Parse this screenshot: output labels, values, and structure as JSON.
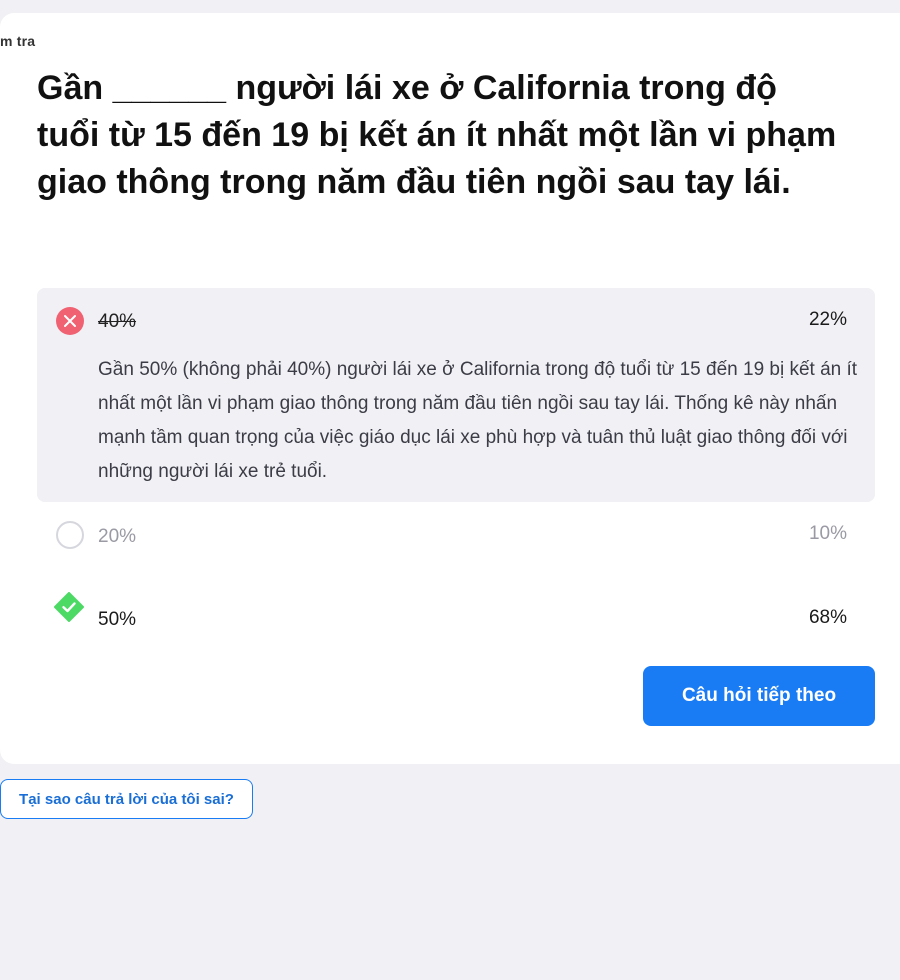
{
  "breadcrumb": "m tra",
  "question": "Gần ______ người lái xe ở California trong độ tuổi từ 15 đến 19 bị kết án ít nhất một lần vi phạm giao thông trong năm đầu tiên ngồi sau tay lái.",
  "options": [
    {
      "label": "40%",
      "percent": "22%",
      "state": "wrong-selected",
      "icon": "x-circle-icon",
      "explanation": "Gần 50% (không phải 40%) người lái xe ở California trong độ tuổi từ 15 đến 19 bị kết án ít nhất một lần vi phạm giao thông trong năm đầu tiên ngồi sau tay lái. Thống kê này nhấn mạnh tầm quan trọng của việc giáo dục lái xe phù hợp và tuân thủ luật giao thông đối với những người lái xe trẻ tuổi."
    },
    {
      "label": "20%",
      "percent": "10%",
      "state": "unselected",
      "icon": "empty-circle-icon"
    },
    {
      "label": "50%",
      "percent": "68%",
      "state": "correct",
      "icon": "check-diamond-icon"
    }
  ],
  "next_button": "Câu hỏi tiếp theo",
  "why_button": "Tại sao câu trả lời của tôi sai?",
  "colors": {
    "background": "#f0f0f5",
    "card": "#ffffff",
    "wrong": "#f06272",
    "correct": "#4cd964",
    "accent": "#1a7cf5"
  }
}
